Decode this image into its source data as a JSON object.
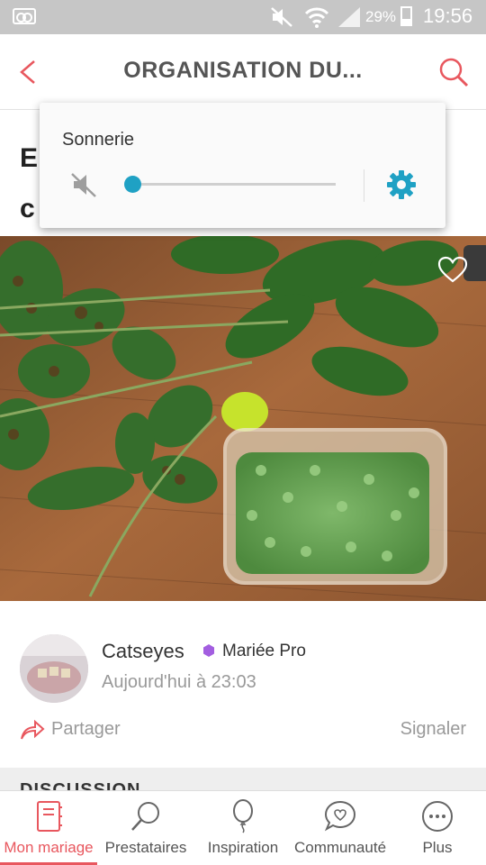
{
  "status_bar": {
    "battery_percent": "29%",
    "time": "19:56"
  },
  "header": {
    "title": "ORGANISATION DU...",
    "back_icon": "chevron-left-icon",
    "search_icon": "search-icon",
    "accent_color": "#e8575e"
  },
  "article": {
    "title_line1": "E",
    "title_line2": "c"
  },
  "post": {
    "author_name": "Catseyes",
    "badge_label": "Mariée Pro",
    "badge_color": "#a35ee0",
    "timestamp": "Aujourd'hui à 23:03",
    "share_label": "Partager",
    "report_label": "Signaler"
  },
  "section": {
    "heading": "DISCUSSION"
  },
  "volume_popup": {
    "title": "Sonnerie",
    "level": 0,
    "muted": true,
    "accent_color": "#1fa1c4"
  },
  "bottom_nav": {
    "items": [
      {
        "label": "Mon mariage",
        "icon": "notebook-icon",
        "active": true
      },
      {
        "label": "Prestataires",
        "icon": "search-icon",
        "active": false
      },
      {
        "label": "Inspiration",
        "icon": "balloon-icon",
        "active": false
      },
      {
        "label": "Communauté",
        "icon": "chat-heart-icon",
        "active": false
      },
      {
        "label": "Plus",
        "icon": "more-icon",
        "active": false
      }
    ]
  }
}
